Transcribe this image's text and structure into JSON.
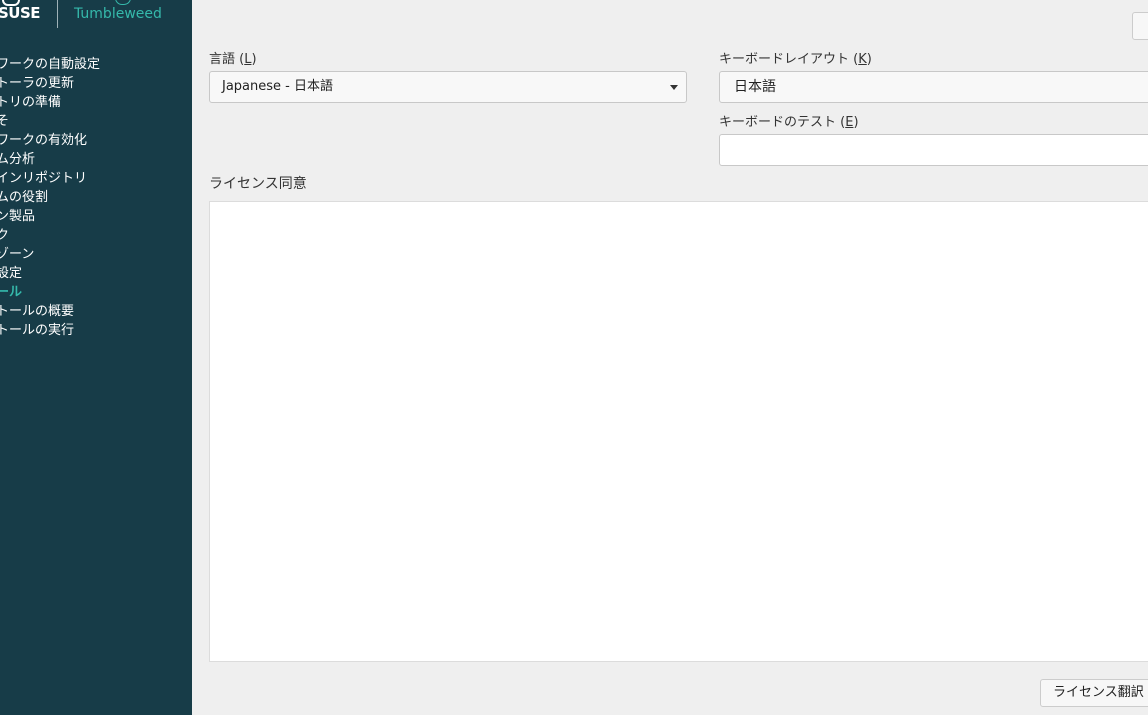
{
  "brand": {
    "logo_text": "SUSE",
    "product": "Tumbleweed"
  },
  "sidebar": {
    "steps": [
      {
        "label": "ワークの自動設定",
        "active": false
      },
      {
        "label": "トーラの更新",
        "active": false
      },
      {
        "label": "トリの準備",
        "active": false
      },
      {
        "label": "そ",
        "active": false
      },
      {
        "label": "ワークの有効化",
        "active": false
      },
      {
        "label": "ム分析",
        "active": false
      },
      {
        "label": "インリポジトリ",
        "active": false
      },
      {
        "label": "ムの役割",
        "active": false
      },
      {
        "label": "ン製品",
        "active": false
      },
      {
        "label": "ク",
        "active": false
      },
      {
        "label": "ゾーン",
        "active": false
      },
      {
        "label": "設定",
        "active": false
      },
      {
        "label": "ール",
        "active": true
      },
      {
        "label": "トールの概要",
        "active": false
      },
      {
        "label": "トールの実行",
        "active": false
      }
    ]
  },
  "language": {
    "label_text": "言語",
    "label_shortcut": "L",
    "selected": "Japanese - 日本語"
  },
  "keyboard": {
    "label_text": "キーボードレイアウト",
    "label_shortcut": "K",
    "selected": "日本語"
  },
  "keyboard_test": {
    "label_text": "キーボードのテスト",
    "label_shortcut": "E",
    "value": ""
  },
  "license": {
    "label": "ライセンス同意",
    "content": ""
  },
  "buttons": {
    "license_translation": "ライセンス翻訳"
  }
}
